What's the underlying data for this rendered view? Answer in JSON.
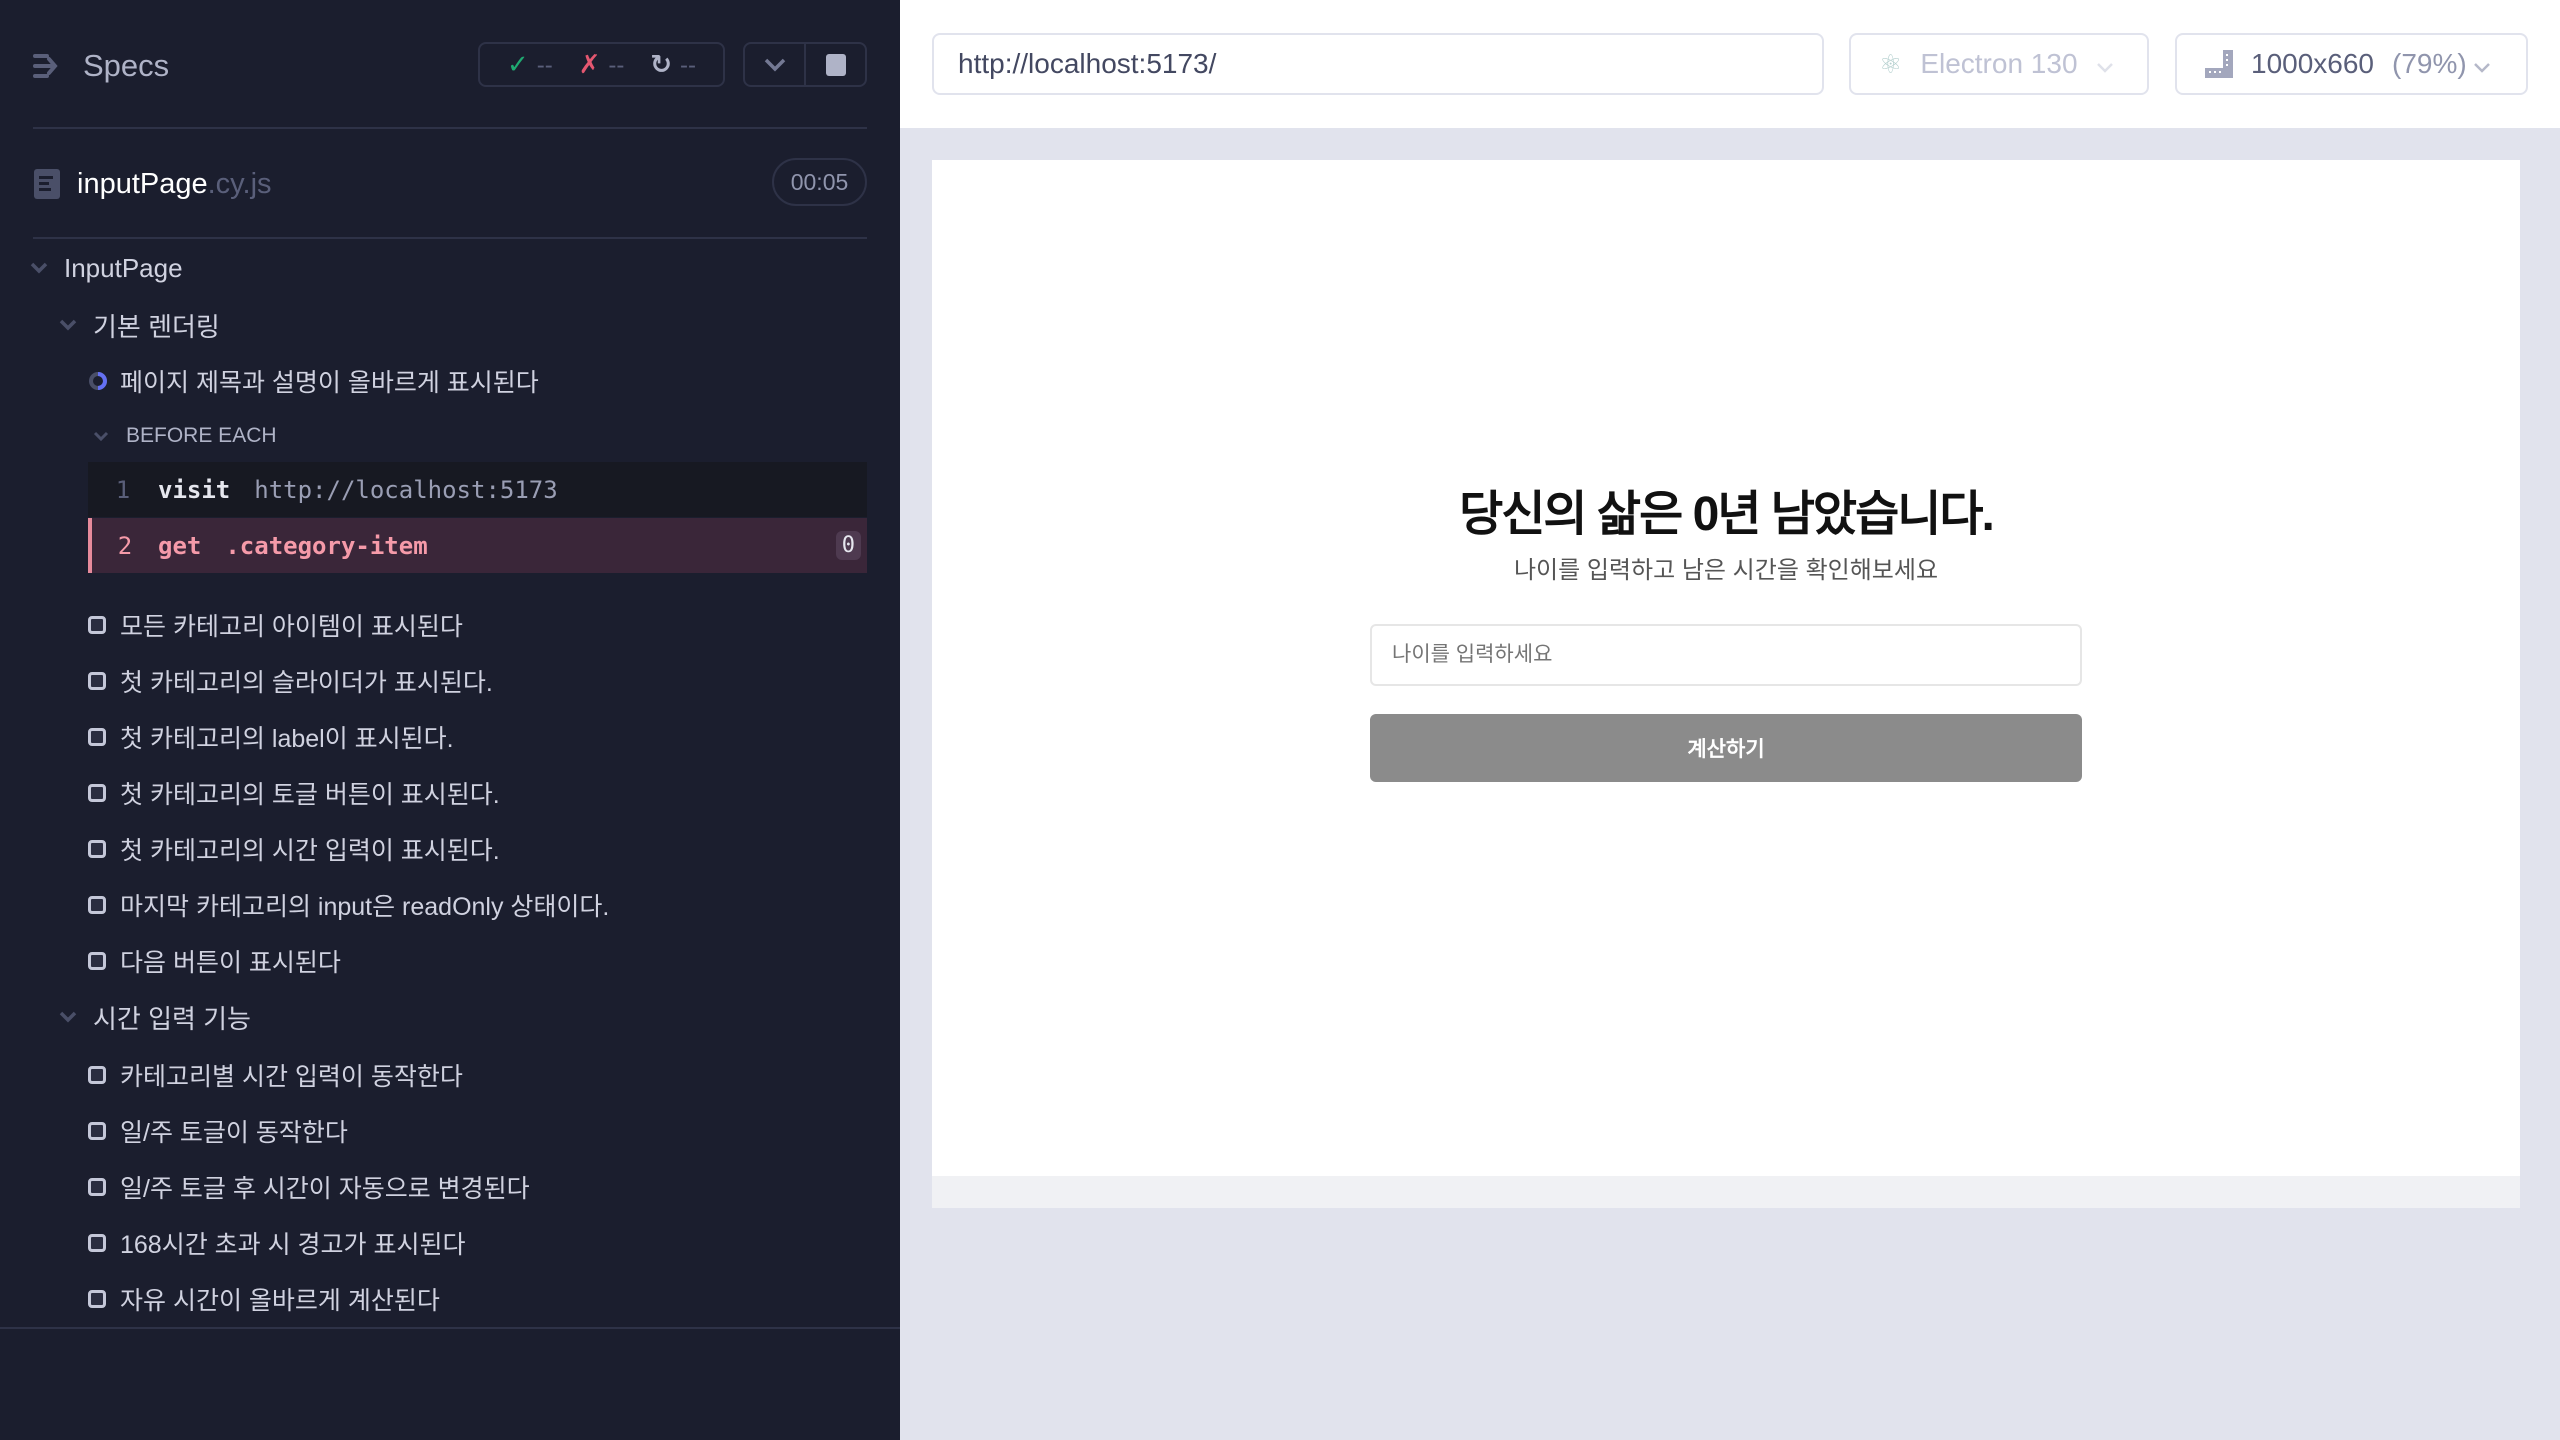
{
  "runner": {
    "title": "Specs",
    "stats": {
      "passed": "--",
      "failed": "--",
      "pending": "--"
    },
    "file": {
      "name": "inputPage",
      "ext": ".cy.js",
      "duration": "00:05"
    },
    "suite": "InputPage",
    "groups": [
      {
        "title": "기본 렌더링",
        "tests": [
          {
            "title": "페이지 제목과 설명이 올바르게 표시된다",
            "state": "running"
          },
          {
            "title": "모든 카테고리 아이템이 표시된다",
            "state": "pending"
          },
          {
            "title": "첫 카테고리의 슬라이더가 표시된다.",
            "state": "pending"
          },
          {
            "title": "첫 카테고리의 label이 표시된다.",
            "state": "pending"
          },
          {
            "title": "첫 카테고리의 토글 버튼이 표시된다.",
            "state": "pending"
          },
          {
            "title": "첫 카테고리의 시간 입력이 표시된다.",
            "state": "pending"
          },
          {
            "title": "마지막 카테고리의 input은 readOnly 상태이다.",
            "state": "pending"
          },
          {
            "title": "다음 버튼이 표시된다",
            "state": "pending"
          }
        ]
      },
      {
        "title": "시간 입력 기능",
        "tests": [
          {
            "title": "카테고리별 시간 입력이 동작한다",
            "state": "pending"
          },
          {
            "title": "일/주 토글이 동작한다",
            "state": "pending"
          },
          {
            "title": "일/주 토글 후 시간이 자동으로 변경된다",
            "state": "pending"
          },
          {
            "title": "168시간 초과 시 경고가 표시된다",
            "state": "pending"
          },
          {
            "title": "자유 시간이 올바르게 계산된다",
            "state": "pending"
          }
        ]
      }
    ],
    "before_each": {
      "label": "BEFORE EACH",
      "commands": [
        {
          "num": "1",
          "name": "visit",
          "arg": "http://localhost:5173"
        },
        {
          "num": "2",
          "name": "get",
          "arg": ".category-item",
          "count": "0",
          "state": "failed"
        }
      ]
    }
  },
  "toolbar": {
    "url": "http://localhost:5173/",
    "browser": "Electron 130",
    "viewport": "1000x660",
    "zoom": "(79%)"
  },
  "app": {
    "title": "당신의 삶은 0년 남았습니다.",
    "subtitle": "나이를 입력하고 남은 시간을 확인해보세요",
    "age_placeholder": "나이를 입력하세요",
    "age_value": "",
    "calculate_label": "계산하기"
  },
  "colors": {
    "panel": "#1b1e2e",
    "passed": "#1fa971",
    "failed": "#e45770",
    "running": "#6470f3",
    "button": "#8b8b8b"
  }
}
